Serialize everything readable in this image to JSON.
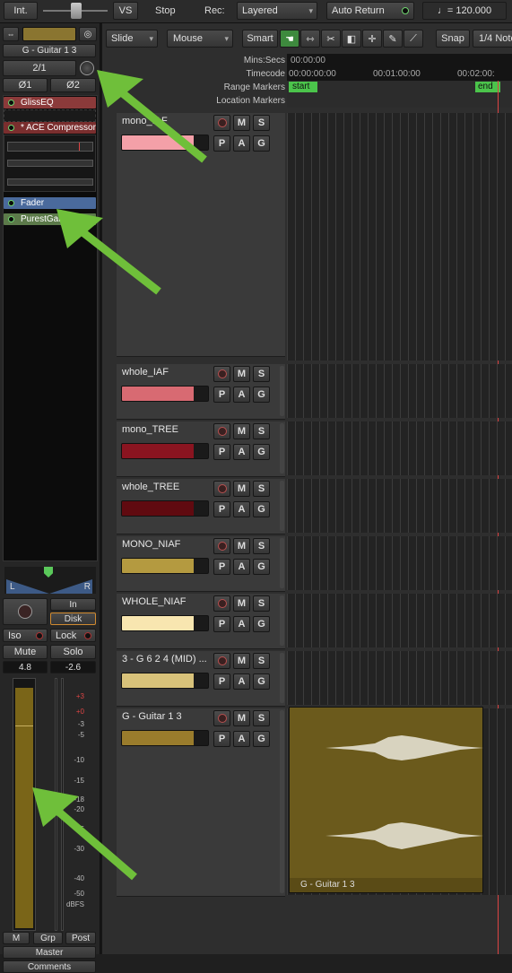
{
  "transport": {
    "int": "Int.",
    "vs": "VS",
    "stop": "Stop",
    "rec_label": "Rec:",
    "rec_mode": "Layered",
    "auto_return": "Auto Return",
    "tempo": "♩= 120.000"
  },
  "toolbar": {
    "slide": "Slide",
    "mouse": "Mouse",
    "smart": "Smart",
    "snap": "Snap",
    "note": "1/4 Note"
  },
  "rulers": {
    "mins_secs": "Mins:Secs",
    "timecode": "Timecode",
    "range_markers": "Range Markers",
    "location_markers": "Location Markers",
    "t0": "00:00:00",
    "tc0": "00:00:00:00",
    "tc1": "00:01:00:00",
    "tc2": "00:02:00:",
    "start": "start",
    "end": "end"
  },
  "strip": {
    "name": "G - Guitar 1 3",
    "input": "2/1",
    "phase1": "Ø1",
    "phase2": "Ø2",
    "inserts": [
      {
        "label": "GlissEQ",
        "color": "#8b3a3a"
      },
      {
        "label": "* ACE Compressor",
        "color": "#7a2e2e"
      },
      {
        "label": "Fader",
        "color": "#4a6a9c"
      },
      {
        "label": "PurestGain",
        "color": "#5c7a4a"
      }
    ],
    "pan_l": "L",
    "pan_r": "R",
    "in": "In",
    "disk": "Disk",
    "iso": "Iso",
    "lock": "Lock",
    "mute": "Mute",
    "solo": "Solo",
    "gain": "4.8",
    "peak": "-2.6",
    "scale": [
      "+3",
      "+0",
      "-3",
      "-5",
      "-10",
      "-15",
      "-18",
      "-20",
      "-25",
      "-30",
      "-40",
      "-50",
      "dBFS"
    ],
    "m": "M",
    "grp": "Grp",
    "post": "Post",
    "master": "Master",
    "comments": "Comments"
  },
  "track_buttons": {
    "m": "M",
    "s": "S",
    "p": "P",
    "a": "A",
    "g": "G"
  },
  "tracks": [
    {
      "name": "mono_IAF",
      "color": "#f4a0a8"
    },
    {
      "name": "whole_IAF",
      "color": "#d86a72"
    },
    {
      "name": "mono_TREE",
      "color": "#8a1420"
    },
    {
      "name": "whole_TREE",
      "color": "#600a10"
    },
    {
      "name": "MONO_NIAF",
      "color": "#b49a40"
    },
    {
      "name": "WHOLE_NIAF",
      "color": "#f8e6b0"
    },
    {
      "name": "3 - G 6 2 4 (MID) ...",
      "color": "#d8c27a"
    },
    {
      "name": "G - Guitar 1 3",
      "color": "#9a7c2c"
    }
  ],
  "region": {
    "label": "G - Guitar 1 3",
    "color": "#6b5a1c"
  }
}
